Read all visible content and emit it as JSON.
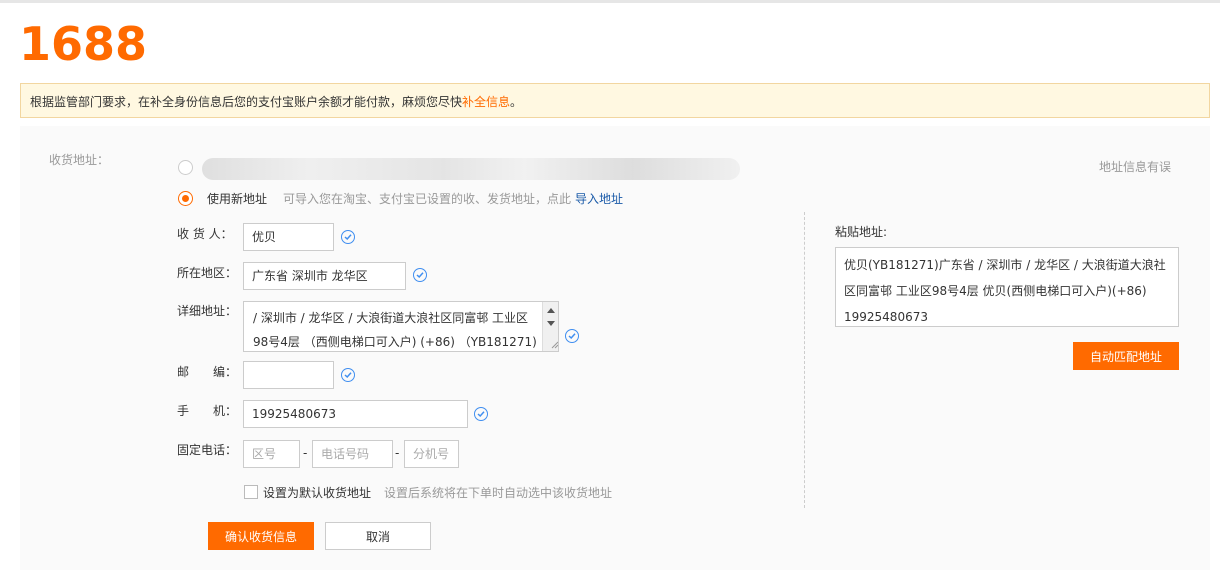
{
  "logo": "1688",
  "notice": {
    "text": "根据监管部门要求，在补全身份信息后您的支付宝账户余额才能付款，麻烦您尽快",
    "link": "补全信息",
    "end": "。"
  },
  "form": {
    "shipping_label": "收货地址：",
    "address_error_link": "地址信息有误",
    "new_address": {
      "label": "使用新地址",
      "hint": "可导入您在淘宝、支付宝已设置的收、发货地址，点此",
      "import_link": "导入地址"
    },
    "consignee": {
      "label": "收 货 人：",
      "value": "优贝"
    },
    "region": {
      "label": "所在地区：",
      "value": "广东省 深圳市 龙华区"
    },
    "detail": {
      "label": "详细地址：",
      "line1": "/ 深圳市 / 龙华区 / 大浪街道大浪社区同富邨 工业区",
      "line2": "98号4层 （西侧电梯口可入户) (+86) （YB181271)"
    },
    "postcode": {
      "label": "邮　　编：",
      "value": ""
    },
    "mobile": {
      "label": "手　　机：",
      "value": "19925480673"
    },
    "phone": {
      "label": "固定电话：",
      "area_placeholder": "区号",
      "number_placeholder": "电话号码",
      "ext_placeholder": "分机号",
      "sep": "-"
    },
    "default": {
      "label": "设置为默认收货地址",
      "hint": "设置后系统将在下单时自动选中该收货地址"
    },
    "confirm_button": "确认收货信息",
    "cancel_button": "取消"
  },
  "paste": {
    "label": "粘贴地址:",
    "line1": "优贝(YB181271)广东省 / 深圳市 / 龙华区 / 大浪街道大浪社",
    "line2": "区同富邨 工业区98号4层 优贝(西侧电梯口可入户)(+86)",
    "line3": "19925480673",
    "match_button": "自动匹配地址"
  },
  "colors": {
    "accent": "#ff6a00",
    "link": "#1a5aa8",
    "check": "#3f8ef0"
  }
}
